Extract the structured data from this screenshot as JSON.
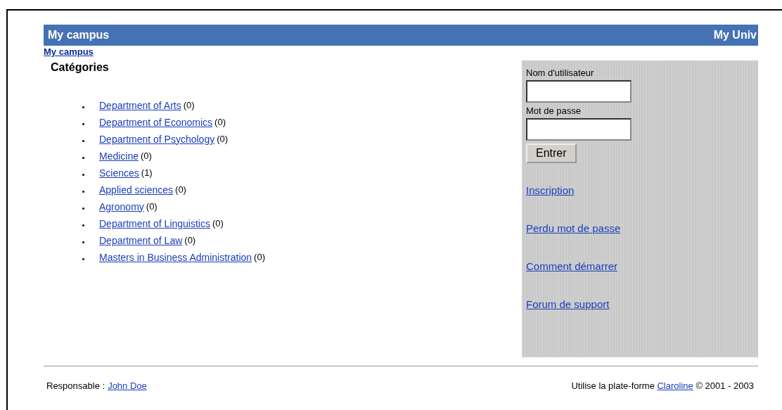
{
  "header": {
    "title": "My campus",
    "site": "My Univ"
  },
  "breadcrumb": "My campus",
  "categories": {
    "title": "Catégories",
    "items": [
      {
        "name": "Department of Arts",
        "count": "(0)"
      },
      {
        "name": "Department of Economics",
        "count": "(0)"
      },
      {
        "name": "Department of Psychology",
        "count": "(0)"
      },
      {
        "name": "Medicine",
        "count": "(0)"
      },
      {
        "name": "Sciences",
        "count": "(1)"
      },
      {
        "name": "Applied sciences",
        "count": "(0)"
      },
      {
        "name": "Agronomy",
        "count": "(0)"
      },
      {
        "name": "Department of Linguistics",
        "count": "(0)"
      },
      {
        "name": "Department of Law",
        "count": "(0)"
      },
      {
        "name": "Masters in Business Administration",
        "count": "(0)"
      }
    ]
  },
  "login": {
    "username_label": "Nom d'utilisateur",
    "password_label": "Mot de passe",
    "button": "Entrer",
    "links": [
      "Inscription",
      "Perdu mot de passe",
      "Comment démarrer",
      "Forum de support"
    ]
  },
  "footer": {
    "manager_label": "Responsable :",
    "manager": "John Doe",
    "credit_before": "Utilise la plate-forme",
    "credit_link": "Claroline",
    "credit_after": "© 2001 - 2003"
  }
}
